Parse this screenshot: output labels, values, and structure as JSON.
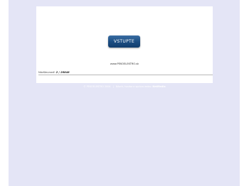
{
  "main": {
    "enter_button_label": "VSTUPTE",
    "site_link": "www.PEKOELEKTRO.sk"
  },
  "counter": {
    "label": "Návštevnosť:",
    "count": "2 / 26848"
  },
  "footer": {
    "left_text": "© PEKOELEKTRO 2004",
    "separator": "|",
    "middle_text": "Návrh, tvorba a správa webu:",
    "right_text": "NetMedia"
  }
}
